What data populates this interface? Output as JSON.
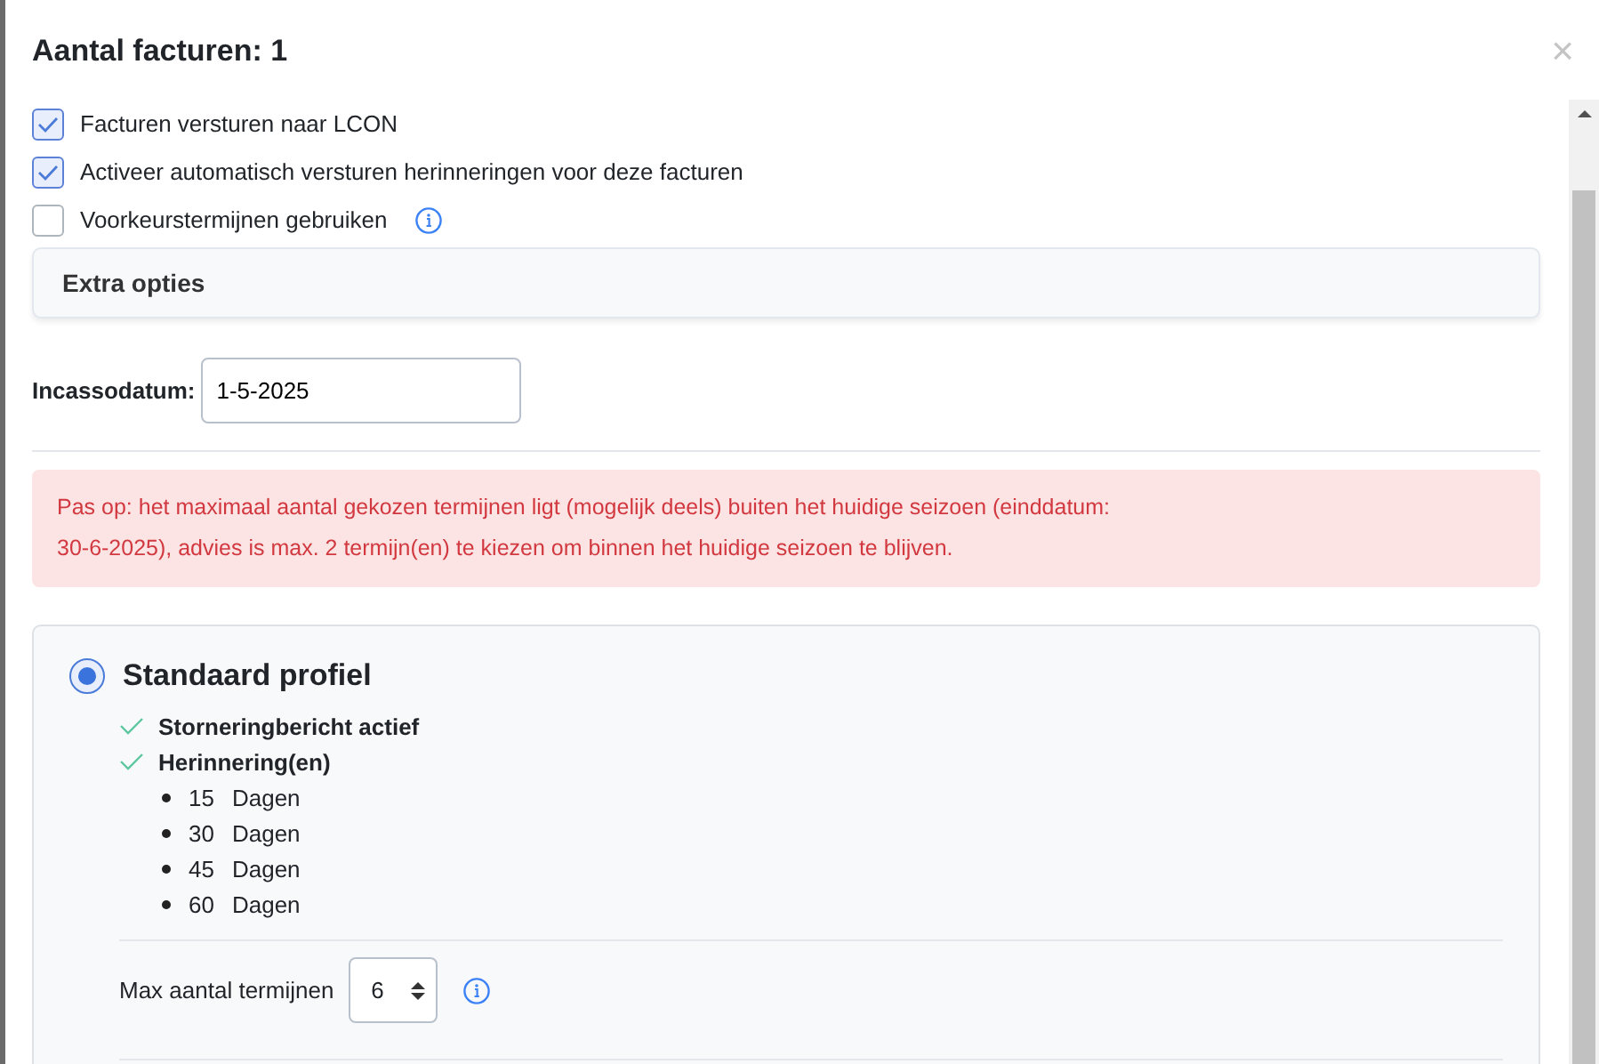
{
  "dialog": {
    "title": "Aantal facturen: 1",
    "close": "×"
  },
  "checkboxes": [
    {
      "label": "Facturen versturen naar LCON",
      "checked": true,
      "info": false
    },
    {
      "label": "Activeer automatisch versturen herinneringen voor deze facturen",
      "checked": true,
      "info": false
    },
    {
      "label": "Voorkeurstermijnen gebruiken",
      "checked": false,
      "info": true
    }
  ],
  "extra_options": {
    "title": "Extra opties"
  },
  "collection_date": {
    "label": "Incassodatum:",
    "value": "1-5-2025"
  },
  "warning": "Pas op: het maximaal aantal gekozen termijnen ligt (mogelijk deels) buiten het huidige seizoen (einddatum: 30-6-2025), advies is max. 2 termijn(en) te kiezen om binnen het huidige seizoen te blijven.",
  "profile": {
    "title": "Standaard profiel",
    "selected": true,
    "features": [
      {
        "label": "Storneringbericht actief"
      },
      {
        "label": "Herinnering(en)"
      }
    ],
    "reminders": [
      {
        "days": "15",
        "unit": "Dagen"
      },
      {
        "days": "30",
        "unit": "Dagen"
      },
      {
        "days": "45",
        "unit": "Dagen"
      },
      {
        "days": "60",
        "unit": "Dagen"
      }
    ],
    "max_terms": {
      "label": "Max aantal termijnen",
      "value": "6"
    }
  }
}
